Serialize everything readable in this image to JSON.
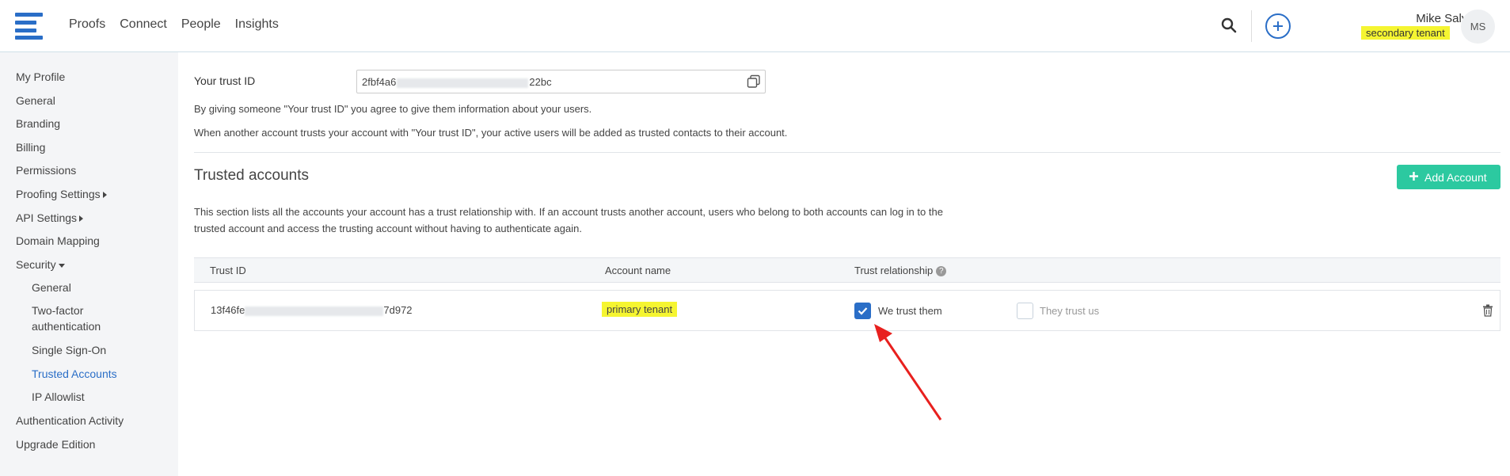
{
  "nav": {
    "items": [
      "Proofs",
      "Connect",
      "People",
      "Insights"
    ]
  },
  "user": {
    "name": "Mike Salyga",
    "tenant": "secondary tenant",
    "initials": "MS"
  },
  "sidebar": {
    "items": [
      {
        "label": "My Profile"
      },
      {
        "label": "General"
      },
      {
        "label": "Branding"
      },
      {
        "label": "Billing"
      },
      {
        "label": "Permissions"
      },
      {
        "label": "Proofing Settings"
      },
      {
        "label": "API Settings"
      },
      {
        "label": "Domain Mapping"
      },
      {
        "label": "Security"
      },
      {
        "label": "General"
      },
      {
        "label": "Two-factor authentication"
      },
      {
        "label": "Single Sign-On"
      },
      {
        "label": "Trusted Accounts"
      },
      {
        "label": "IP Allowlist"
      },
      {
        "label": "Authentication Activity"
      },
      {
        "label": "Upgrade Edition"
      }
    ]
  },
  "trust": {
    "label": "Your trust ID",
    "id_start": "2fbf4a6",
    "id_end": "22bc",
    "info1": "By giving someone \"Your trust ID\" you agree to give them information about your users.",
    "info2": "When another account trusts your account with \"Your trust ID\", your active users will be added as trusted contacts to their account."
  },
  "trusted": {
    "title": "Trusted accounts",
    "add_label": "Add Account",
    "desc1": "This section lists all the accounts your account has a trust relationship with. If an account trusts another account, users who belong to both accounts can log in to the",
    "desc2": "trusted account and access the trusting account without having to authenticate again.",
    "headers": {
      "trust_id": "Trust ID",
      "account_name": "Account name",
      "relationship": "Trust relationship"
    },
    "rows": [
      {
        "id_start": "13f46fe",
        "id_end": "7d972",
        "account_name": "primary tenant",
        "we_trust": "We trust them",
        "they_trust": "They trust us"
      }
    ]
  },
  "colors": {
    "accent": "#2a6ec7",
    "add_button": "#2cc9a0",
    "highlight": "#f5f531",
    "annotation_arrow": "#e8201e"
  }
}
